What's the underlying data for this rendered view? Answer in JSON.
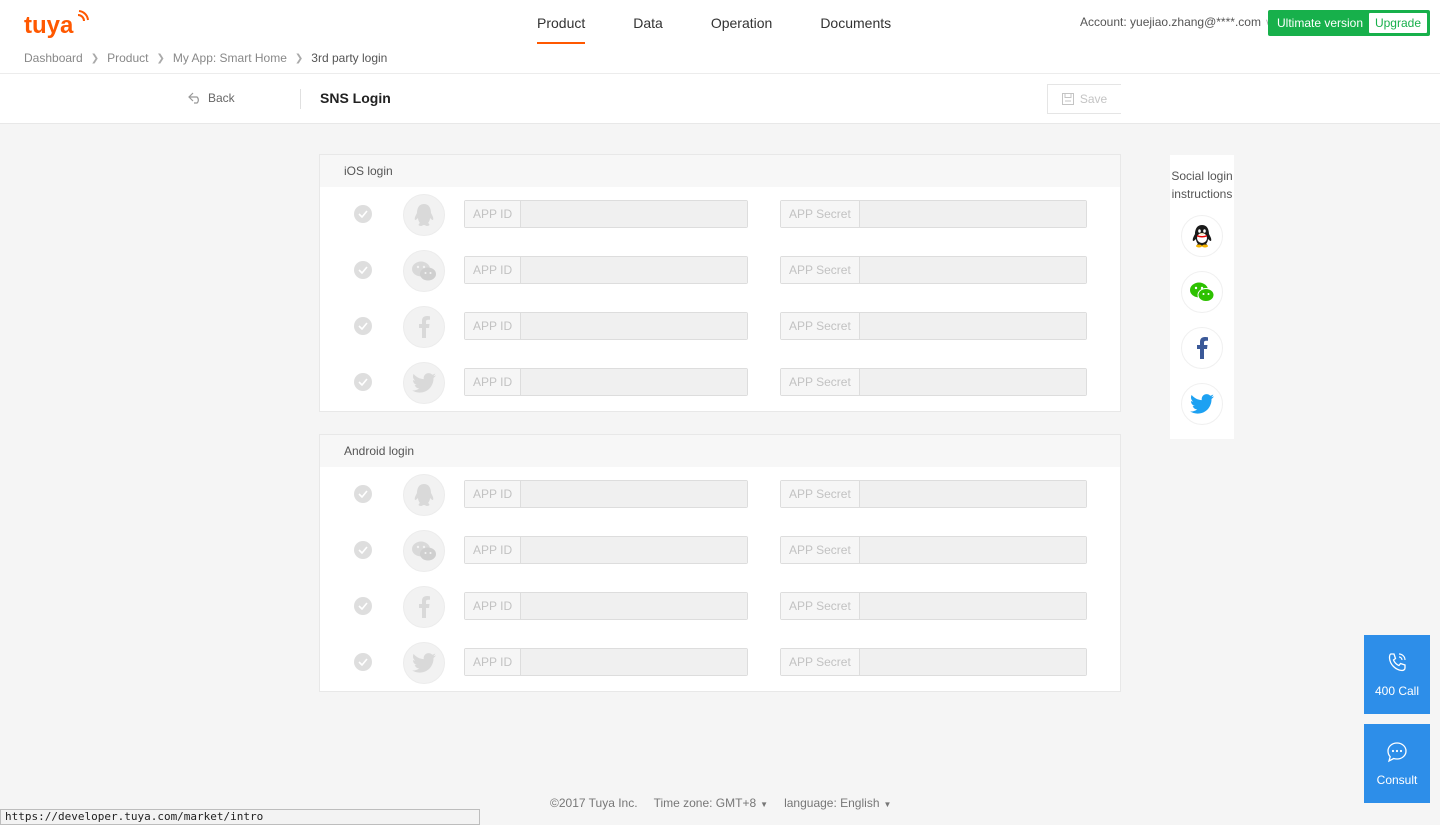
{
  "brand": {
    "logo_text": "tuya",
    "accent": "#ff5800"
  },
  "nav": {
    "items": [
      {
        "label": "Product",
        "active": true
      },
      {
        "label": "Data",
        "active": false
      },
      {
        "label": "Operation",
        "active": false
      },
      {
        "label": "Documents",
        "active": false
      }
    ]
  },
  "account": {
    "label": "Account: yuejiao.zhang@****.com",
    "plan": "Ultimate version",
    "upgrade": "Upgrade"
  },
  "breadcrumb": [
    "Dashboard",
    "Product",
    "My App: Smart Home",
    "3rd party login"
  ],
  "toolbar": {
    "back_label": "Back",
    "title": "SNS Login",
    "save_label": "Save"
  },
  "sections": [
    {
      "title": "iOS login",
      "rows": [
        {
          "provider": "qq-icon",
          "app_id_label": "APP ID",
          "app_secret_label": "APP Secret",
          "app_id": "",
          "app_secret": ""
        },
        {
          "provider": "wechat-icon",
          "app_id_label": "APP ID",
          "app_secret_label": "APP Secret",
          "app_id": "",
          "app_secret": ""
        },
        {
          "provider": "facebook-icon",
          "app_id_label": "APP ID",
          "app_secret_label": "APP Secret",
          "app_id": "",
          "app_secret": ""
        },
        {
          "provider": "twitter-icon",
          "app_id_label": "APP ID",
          "app_secret_label": "APP Secret",
          "app_id": "",
          "app_secret": ""
        }
      ]
    },
    {
      "title": "Android login",
      "rows": [
        {
          "provider": "qq-icon",
          "app_id_label": "APP ID",
          "app_secret_label": "APP Secret",
          "app_id": "",
          "app_secret": ""
        },
        {
          "provider": "wechat-icon",
          "app_id_label": "APP ID",
          "app_secret_label": "APP Secret",
          "app_id": "",
          "app_secret": ""
        },
        {
          "provider": "facebook-icon",
          "app_id_label": "APP ID",
          "app_secret_label": "APP Secret",
          "app_id": "",
          "app_secret": ""
        },
        {
          "provider": "twitter-icon",
          "app_id_label": "APP ID",
          "app_secret_label": "APP Secret",
          "app_id": "",
          "app_secret": ""
        }
      ]
    }
  ],
  "side_panel": {
    "title": "Social login instructions",
    "icons": [
      "qq-icon",
      "wechat-icon",
      "facebook-icon",
      "twitter-icon"
    ]
  },
  "float_buttons": {
    "call": "400 Call",
    "consult": "Consult"
  },
  "footer": {
    "copyright": "©2017 Tuya Inc.",
    "timezone": "Time zone:  GMT+8",
    "language": "language: English"
  },
  "status_url": "https://developer.tuya.com/market/intro",
  "colors": {
    "green": "#17b04b",
    "blue": "#2d8ee9",
    "qq": "#1a1a1a",
    "wechat": "#2dc100",
    "facebook": "#3b5998",
    "twitter": "#1da1f2"
  }
}
